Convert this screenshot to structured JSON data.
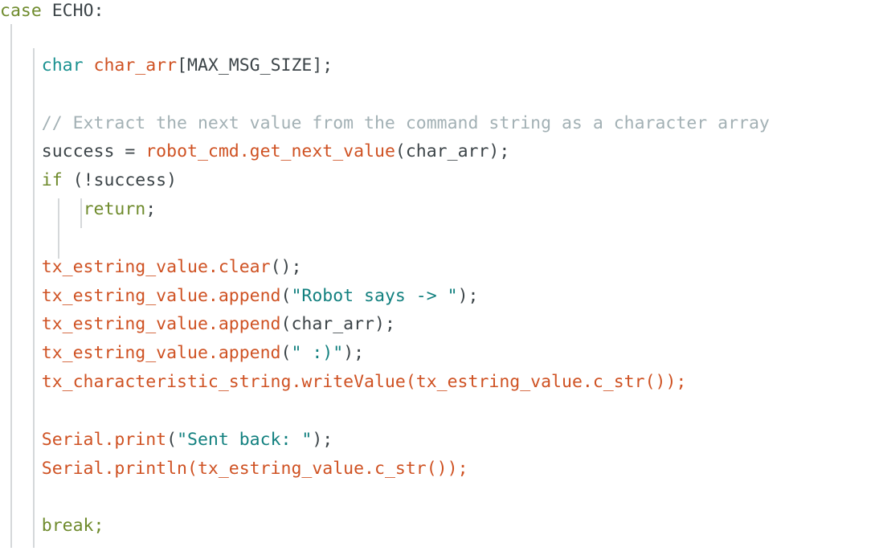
{
  "editor": {
    "background_color": "#ffffff",
    "language": "cpp",
    "font_family_kind": "monospace",
    "indent_guide_color": "#d5d8da"
  },
  "palette": {
    "keyword": "#6f8b2d",
    "type": "#1a9190",
    "identifier": "#3c4448",
    "function_call": "#cf5223",
    "string": "#12807f",
    "comment": "#a3b1b5"
  },
  "code": {
    "line1": {
      "kw": "case",
      "sp": " ",
      "ident": "ECHO:"
    },
    "line2": {
      "indent": "    ",
      "type": "char",
      "sp": " ",
      "fn": "char_arr",
      "ident": "[MAX_MSG_SIZE];"
    },
    "line3": {
      "indent": "    ",
      "cmt": "// Extract the next value from the command string as a character array"
    },
    "line4": {
      "indent": "    ",
      "pre": "success = ",
      "fn": "robot_cmd.get_next_value",
      "post": "(char_arr);"
    },
    "line5": {
      "indent": "    ",
      "kw": "if",
      "post": " (!success)"
    },
    "line6": {
      "indent": "        ",
      "kw": "return",
      "post": ";"
    },
    "line7": {
      "indent": "    ",
      "fn": "tx_estring_value.clear",
      "post": "();"
    },
    "line8": {
      "indent": "    ",
      "fn": "tx_estring_value.append",
      "p1": "(",
      "str": "\"Robot says -> \"",
      "p2": ");"
    },
    "line9": {
      "indent": "    ",
      "fn": "tx_estring_value.append",
      "p1": "(",
      "arg": "char_arr",
      "p2": ");"
    },
    "line10": {
      "indent": "    ",
      "fn": "tx_estring_value.append",
      "p1": "(",
      "str": "\" :)\"",
      "p2": ");"
    },
    "line11": {
      "indent": "    ",
      "fn": "tx_characteristic_string.writeValue",
      "p1": "(",
      "fn2": "tx_estring_value.c_str",
      "p2": "());"
    },
    "line12": {
      "indent": "    ",
      "fn": "Serial.print",
      "p1": "(",
      "str": "\"Sent back: \"",
      "p2": ");"
    },
    "line13": {
      "indent": "    ",
      "fn": "Serial.println",
      "p1": "(",
      "fn2": "tx_estring_value.c_str",
      "p2": "());"
    },
    "line14": {
      "indent": "    ",
      "kw": "break",
      "post": ";"
    }
  }
}
